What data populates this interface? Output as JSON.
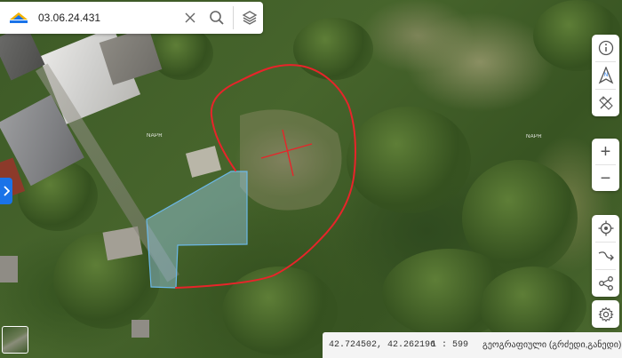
{
  "search": {
    "value": "03.06.24.431",
    "logo_icon": "napr-logo-icon",
    "clear_icon": "close-icon",
    "search_icon": "search-icon",
    "layers_icon": "layers-icon"
  },
  "map": {
    "labels": [
      "NAPR",
      "NAPR"
    ],
    "boundary_color": "#e8242a",
    "parcel_fill": "#9fd3f5",
    "parcel_stroke": "#6bb8e8"
  },
  "controls": {
    "info_icon": "info-icon",
    "compass_icon": "compass-north-icon",
    "compass_label": "N",
    "measure_icon": "ruler-pencil-icon",
    "zoom_in": "+",
    "zoom_out": "−",
    "locate_icon": "locate-target-icon",
    "route_icon": "route-path-icon",
    "share_icon": "share-icon",
    "settings_icon": "gear-icon"
  },
  "side_toggle": {
    "icon": "chevron-right-icon"
  },
  "status": {
    "coordinates": "42.724502, 42.262196",
    "scale": "1 : 599",
    "basemap_label": "გეოგრაფიული (გრძედი,განედი)"
  },
  "accent_color": "#1a73e8"
}
